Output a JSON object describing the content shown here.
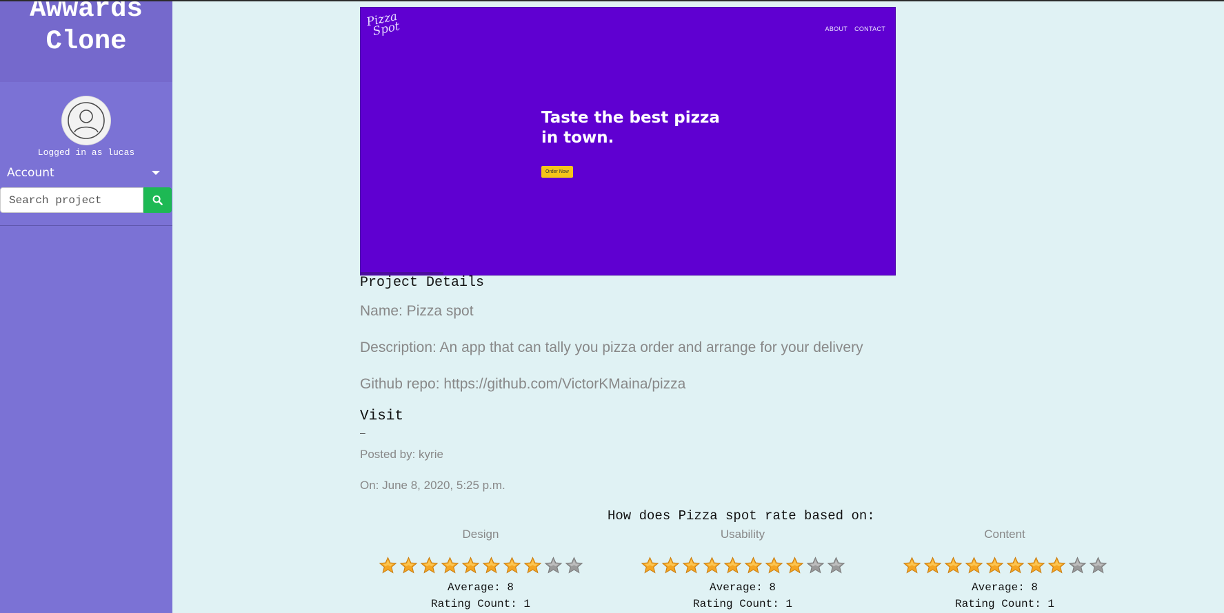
{
  "sidebar": {
    "brand_line1": "Awwards",
    "brand_line2": "Clone",
    "logged_in": "Logged in as lucas",
    "account_label": "Account",
    "search_placeholder": "Search project"
  },
  "hero": {
    "logo_line1": "Pizza",
    "logo_line2": "Spot",
    "nav": [
      "ABOUT",
      "CONTACT"
    ],
    "title_line1": "Taste the best pizza",
    "title_line2": "in town.",
    "button": "Order Now"
  },
  "project": {
    "section_title": "Project Details",
    "name": "Name: Pizza spot",
    "description": "Description: An app that can tally you pizza order and arrange for your delivery",
    "github": "Github repo: https://github.com/VictorKMaina/pizza",
    "visit": "Visit",
    "dash": "–",
    "posted_by": "Posted by: kyrie",
    "posted_on": "On: June 8, 2020, 5:25 p.m."
  },
  "ratings": {
    "title": "How does Pizza spot rate based on:",
    "max_stars": 10,
    "items": [
      {
        "category": "Design",
        "stars_filled": 8,
        "average": "Average: 8",
        "count": "Rating Count: 1"
      },
      {
        "category": "Usability",
        "stars_filled": 8,
        "average": "Average: 8",
        "count": "Rating Count: 1"
      },
      {
        "category": "Content",
        "stars_filled": 8,
        "average": "Average: 8",
        "count": "Rating Count: 1"
      }
    ]
  },
  "colors": {
    "sidebar": "#7b72d5",
    "brand_bg": "#7569cc",
    "page_bg": "#e0f2f4",
    "hero_bg": "#5f00d1",
    "search_button": "#1db954",
    "star_filled": "#f5a623",
    "star_empty": "#9a9a9a"
  },
  "icons": {
    "avatar": "user-avatar-icon",
    "search": "search-icon",
    "caret": "caret-down-icon",
    "star": "star-icon"
  }
}
